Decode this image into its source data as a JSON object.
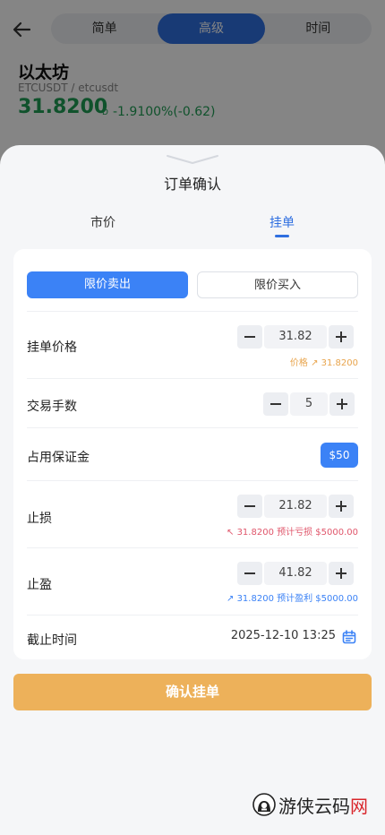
{
  "header": {
    "tabs": [
      "简单",
      "高级",
      "时间"
    ],
    "active_tab": "高级"
  },
  "coin": {
    "name": "以太坊",
    "pair": "ETCUSDT / etcusdt",
    "price": "31.8200",
    "marker": "D",
    "change": "-1.9100%(-0.62)"
  },
  "sheet": {
    "title": "订单确认",
    "tabs": {
      "market": "市价",
      "limit": "挂单"
    },
    "active_tab": "挂单",
    "side_buttons": {
      "sell": "限价卖出",
      "buy": "限价买入"
    },
    "active_side": "限价卖出",
    "rows": {
      "price": {
        "label": "挂单价格",
        "value": "31.82",
        "hint": "价格 ↗ 31.8200"
      },
      "lots": {
        "label": "交易手数",
        "value": "5"
      },
      "margin": {
        "label": "占用保证金",
        "value": "$50"
      },
      "stop_loss": {
        "label": "止损",
        "value": "21.82",
        "hint": "↖ 31.8200 预计亏损 $5000.00"
      },
      "take_profit": {
        "label": "止盈",
        "value": "41.82",
        "hint": "↗ 31.8200 预计盈利 $5000.00"
      },
      "deadline": {
        "label": "截止时间",
        "value": "2025-12-10 13:25"
      }
    },
    "confirm_label": "确认挂单"
  },
  "watermark": {
    "text_main": "游侠云码",
    "text_accent": "网"
  },
  "icons": {
    "back": "arrow-left-icon",
    "calendar": "calendar-icon",
    "minus": "minus-icon",
    "plus": "plus-icon"
  },
  "colors": {
    "accent_blue": "#3b82f6",
    "segment_active": "#2f6fe0",
    "price_green": "#1f9d55",
    "confirm": "#edb15a",
    "loss_red": "#e0566b",
    "hint_orange": "#e8a44c"
  }
}
